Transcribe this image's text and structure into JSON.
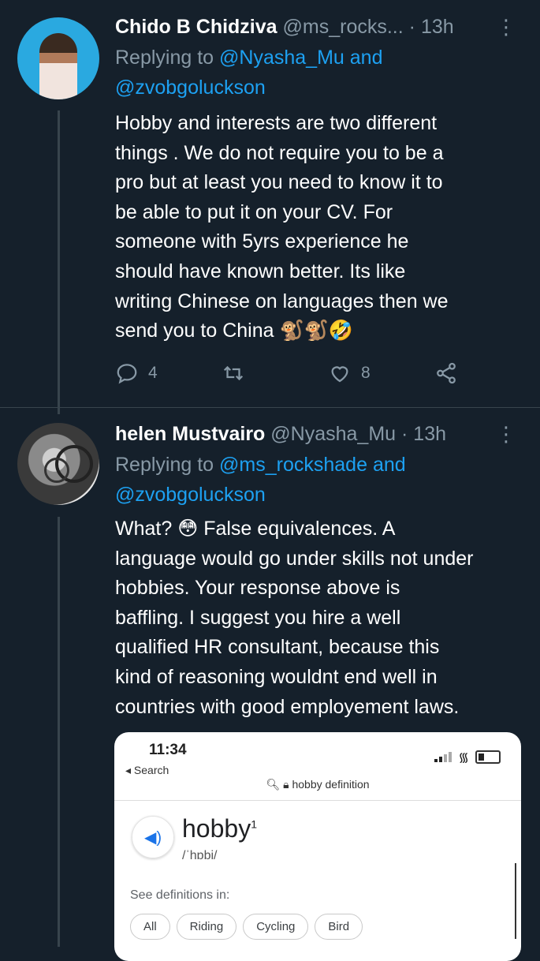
{
  "tweets": [
    {
      "name": "Chido B Chidziva",
      "handle": "@ms_rocks...",
      "dot": "·",
      "time": "13h",
      "replying_prefix": "Replying to",
      "replying_to_1": "@Nyasha_Mu",
      "and": "and",
      "replying_to_2": "@zvobgoluckson",
      "text_lines": [
        "Hobby and interests are two different",
        "things . We do not require you to be a",
        "pro but at least you need to know it to",
        "be able to put it on your CV. For",
        "someone with 5yrs experience he",
        "should have known better. Its like",
        "writing Chinese on languages then we",
        "send you to China 🐒🐒🤣"
      ],
      "reply_count": "4",
      "retweet_count": "",
      "like_count": "8"
    },
    {
      "name": "helen Mustvairo",
      "handle": "@Nyasha_Mu",
      "dot": "·",
      "time": "13h",
      "replying_prefix": "Replying to",
      "replying_to_1": "@ms_rockshade",
      "and": "and",
      "replying_to_2": "@zvobgoluckson",
      "text_lines": [
        "What? 😳 False equivalences. A",
        "language would go under skills not under",
        "hobbies. Your response above is",
        "baffling. I suggest you hire a well",
        "qualified HR consultant, because this",
        "kind of reasoning wouldnt end well in",
        "countries with good employement laws."
      ]
    }
  ],
  "embedded_screenshot": {
    "clock": "11:34",
    "back_label": "◂ Search",
    "url": "hobby definition",
    "word": "hobby",
    "word_sup": "1",
    "phonetic": "/ˈhɒbi/",
    "see_definitions": "See definitions in:",
    "chips": [
      "All",
      "Riding",
      "Cycling",
      "Bird"
    ]
  },
  "colors": {
    "background": "#15202b",
    "mention": "#1da1f2",
    "muted": "#8899a6"
  }
}
